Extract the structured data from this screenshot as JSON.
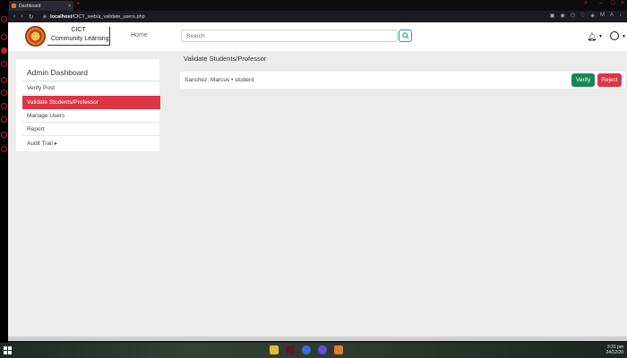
{
  "browser": {
    "tab_title": "Dashboard",
    "tab_close": "×",
    "new_tab": "+",
    "url_host": "localhost",
    "url_path": "/CICT_web/a_validate_users.php"
  },
  "header": {
    "brand_top": "CICT",
    "brand_bottom": "Community Learning",
    "home_label": "Home",
    "search_placeholder": "Search"
  },
  "sidebar": {
    "title": "Admin Dashboard",
    "items": [
      {
        "label": "Verify Post"
      },
      {
        "label": "Validate Students/Professor"
      },
      {
        "label": "Manage Users"
      },
      {
        "label": "Report"
      },
      {
        "label": "Audit Trail ▸"
      }
    ]
  },
  "main": {
    "title": "Validate Students/Professor",
    "users": [
      {
        "text": "Sanchez, Marcus • student",
        "verify_label": "Verify",
        "reject_label": "Reject"
      }
    ]
  },
  "taskbar": {
    "time": "3:31 pm",
    "date": "24/12/20"
  },
  "colors": {
    "accent_red": "#dc3545",
    "verify_green": "#198754",
    "search_teal": "#2a9d8f"
  }
}
